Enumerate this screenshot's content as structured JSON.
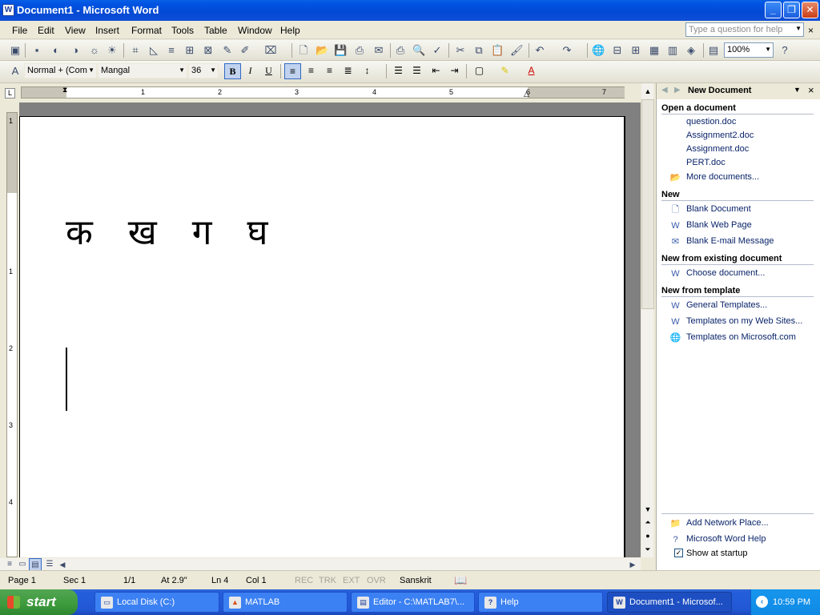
{
  "window": {
    "title": "Document1 - Microsoft Word",
    "minimize": "_",
    "maximize": "❐",
    "close": "✕",
    "app_icon": "W"
  },
  "menubar": {
    "items": [
      "File",
      "Edit",
      "View",
      "Insert",
      "Format",
      "Tools",
      "Table",
      "Window",
      "Help"
    ],
    "help_placeholder": "Type a question for help",
    "close": "×"
  },
  "standard_toolbar": {
    "zoom": "100%"
  },
  "formatting_toolbar": {
    "style": "Normal + (Com",
    "font": "Mangal",
    "size": "36",
    "bold": "B",
    "italic": "I",
    "underline": "U"
  },
  "ruler": {
    "numbers": [
      "1",
      "2",
      "3",
      "4",
      "5",
      "6",
      "7"
    ]
  },
  "vruler": {
    "numbers": [
      "1",
      "1",
      "2",
      "3",
      "4"
    ]
  },
  "document": {
    "text": "क ख ग घ"
  },
  "status": {
    "page": "Page  1",
    "sec": "Sec  1",
    "pages": "1/1",
    "at": "At  2.9\"",
    "ln": "Ln  4",
    "col": "Col  1",
    "rec": "REC",
    "trk": "TRK",
    "ext": "EXT",
    "ovr": "OVR",
    "language": "Sanskrit"
  },
  "taskpane": {
    "title": "New Document",
    "open_heading": "Open a document",
    "recent": [
      "question.doc",
      "Assignment2.doc",
      "Assignment.doc",
      "PERT.doc"
    ],
    "more": "More documents...",
    "new_heading": "New",
    "new_items": [
      "Blank Document",
      "Blank Web Page",
      "Blank E-mail Message"
    ],
    "existing_heading": "New from existing document",
    "choose": "Choose document...",
    "template_heading": "New from template",
    "templates": [
      "General Templates...",
      "Templates on my Web Sites...",
      "Templates on Microsoft.com"
    ],
    "bottom": [
      "Add Network Place...",
      "Microsoft Word Help"
    ],
    "show_startup": "Show at startup"
  },
  "taskbar": {
    "start": "start",
    "buttons": [
      "Local Disk (C:)",
      "MATLAB",
      "Editor - C:\\MATLAB7\\...",
      "Help",
      "Document1 - Microsof..."
    ],
    "clock": "10:59 PM"
  },
  "colors": {
    "titlebar": "#0053E1",
    "taskbar": "#245EDB",
    "start": "#3C9A3C",
    "link": "#0A246A",
    "chrome": "#ECE9D8"
  }
}
